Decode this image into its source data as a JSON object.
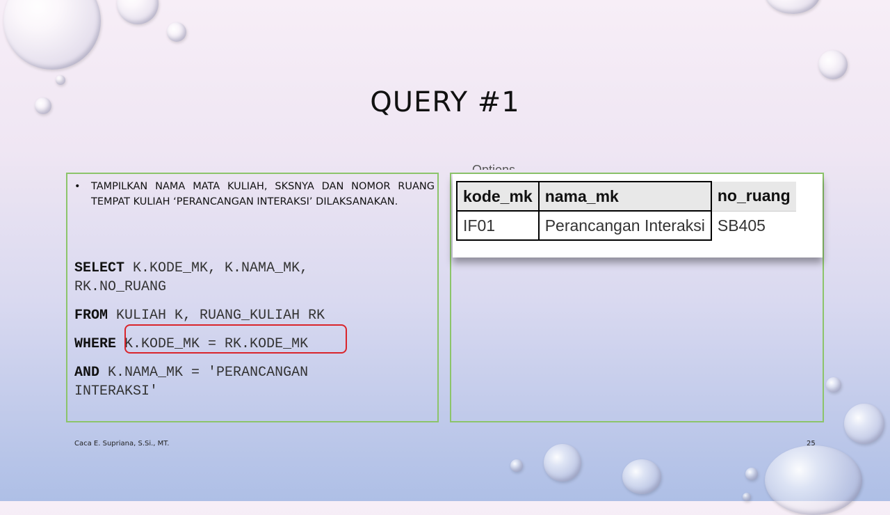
{
  "slide": {
    "title": "QUERY #1",
    "bullet_symbol": "•",
    "bullet_text": "Tampilkan nama mata kuliah, sksnya dan nomor ruang tempat kuliah ‘Perancangan Interaksi’ dilaksanakan.",
    "sql": {
      "select_kw": "SELECT",
      "select_rest": "K.KODE_MK, K.NAMA_MK,",
      "select_rest2": "RK.NO_RUANG",
      "from_kw": "FROM",
      "from_rest": "KULIAH K, RUANG_KULIAH RK",
      "where_kw": "WHERE",
      "where_rest": "K.KODE_MK = RK.KODE_MK",
      "and_kw": "AND",
      "and_rest": "K.NAMA_MK = 'PERANCANGAN",
      "and_rest2": "INTERAKSI'"
    },
    "result_label_cut": "Options",
    "result_table": {
      "headers": [
        "kode_mk",
        "nama_mk",
        "no_ruang"
      ],
      "row": [
        "IF01",
        "Perancangan Interaksi",
        "SB405"
      ]
    },
    "footer_author": "Caca E. Supriana, S.Si., MT.",
    "page_number": "25"
  },
  "colors": {
    "panel_border": "#8cc46a",
    "highlight_border": "#d9242b",
    "link": "#1a55a8"
  }
}
